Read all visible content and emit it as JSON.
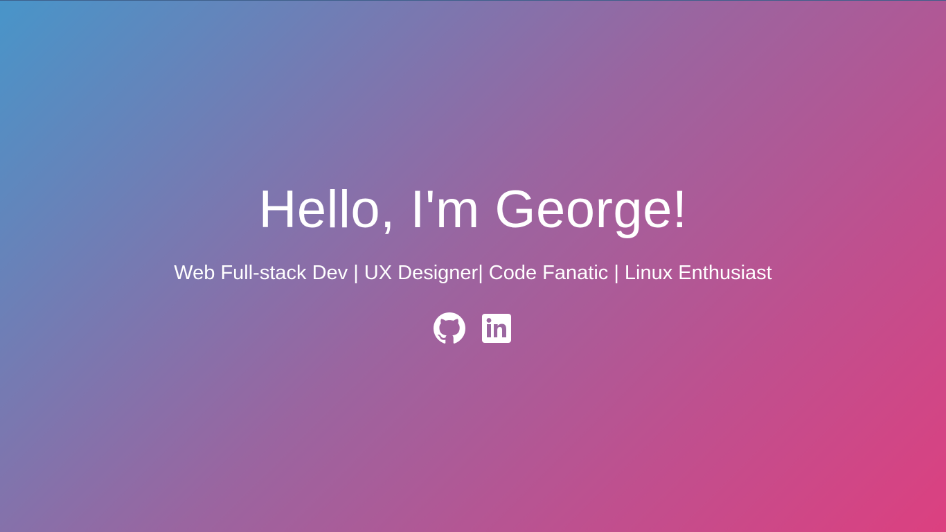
{
  "hero": {
    "title": "Hello, I'm George!",
    "subtitle": "Web Full-stack Dev | UX Designer| Code Fanatic | Linux Enthusiast"
  },
  "social": [
    {
      "icon": "github-icon",
      "label": "GitHub"
    },
    {
      "icon": "linkedin-icon",
      "label": "LinkedIn"
    }
  ],
  "colors": {
    "gradient_start": "#4895c9",
    "gradient_mid": "#9a65a0",
    "gradient_end": "#dc4080",
    "text": "#ffffff"
  }
}
